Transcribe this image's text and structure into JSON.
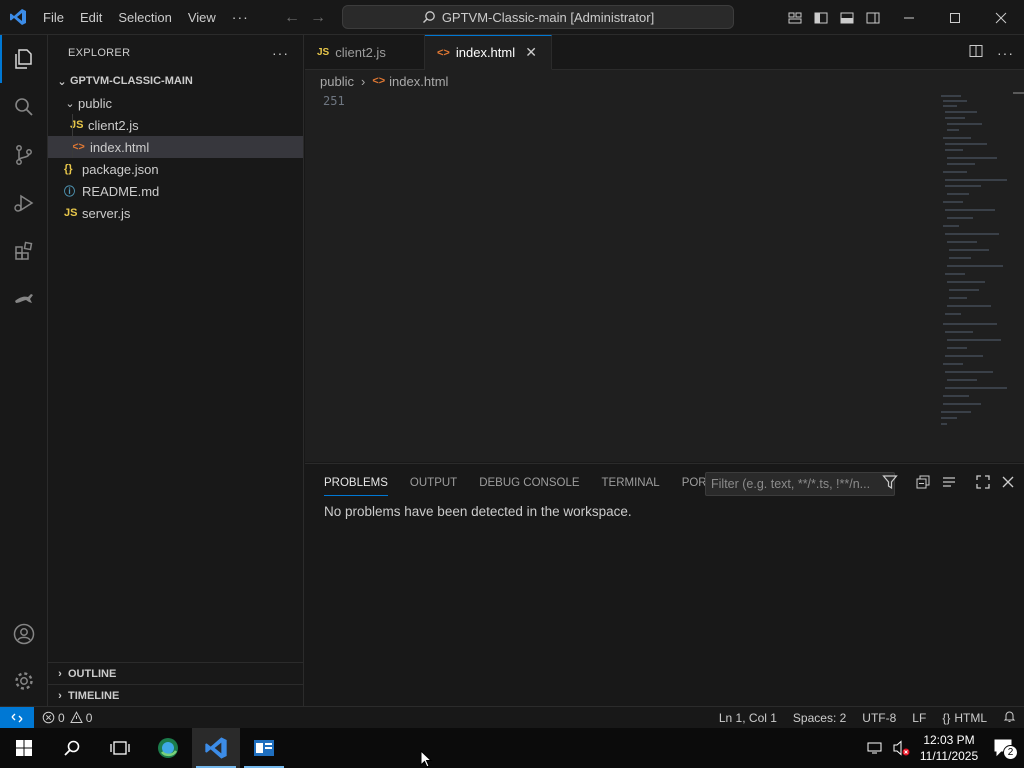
{
  "titlebar": {
    "menu": [
      "File",
      "Edit",
      "Selection",
      "View"
    ],
    "more": "···",
    "search_text": "GPTVM-Classic-main [Administrator]"
  },
  "sidebar": {
    "title": "EXPLORER",
    "more": "···",
    "root_folder": "GPTVM-CLASSIC-MAIN",
    "tree": [
      {
        "label": "public",
        "type": "folder"
      },
      {
        "label": "client2.js",
        "type": "js",
        "icon": "JS"
      },
      {
        "label": "index.html",
        "type": "html",
        "icon": "<>",
        "selected": true
      },
      {
        "label": "package.json",
        "type": "json",
        "icon": "{}"
      },
      {
        "label": "README.md",
        "type": "info",
        "icon": "ⓘ"
      },
      {
        "label": "server.js",
        "type": "js",
        "icon": "JS"
      }
    ],
    "outline": "OUTLINE",
    "timeline": "TIMELINE"
  },
  "tabs": [
    {
      "label": "client2.js",
      "icon": "JS",
      "active": false
    },
    {
      "label": "index.html",
      "icon": "<>",
      "active": true
    }
  ],
  "breadcrumb": {
    "folder": "public",
    "file": "index.html"
  },
  "editor": {
    "line_number": "251"
  },
  "panel": {
    "tabs": [
      "PROBLEMS",
      "OUTPUT",
      "DEBUG CONSOLE",
      "TERMINAL",
      "PORTS"
    ],
    "active_tab": "PROBLEMS",
    "filter_placeholder": "Filter (e.g. text, **/*.ts, !**/n...",
    "message": "No problems have been detected in the workspace."
  },
  "statusbar": {
    "errors": "0",
    "warnings": "0",
    "position": "Ln 1, Col 1",
    "spaces": "Spaces: 2",
    "encoding": "UTF-8",
    "eol": "LF",
    "language": "HTML"
  },
  "taskbar": {
    "time": "12:03 PM",
    "date": "11/11/2025",
    "notification_count": "2"
  },
  "colors": {
    "accent": "#0078d4",
    "editor_bg": "#1f1f1f",
    "sidebar_bg": "#181818",
    "js_icon": "#e8c74a",
    "html_icon": "#e37933"
  }
}
